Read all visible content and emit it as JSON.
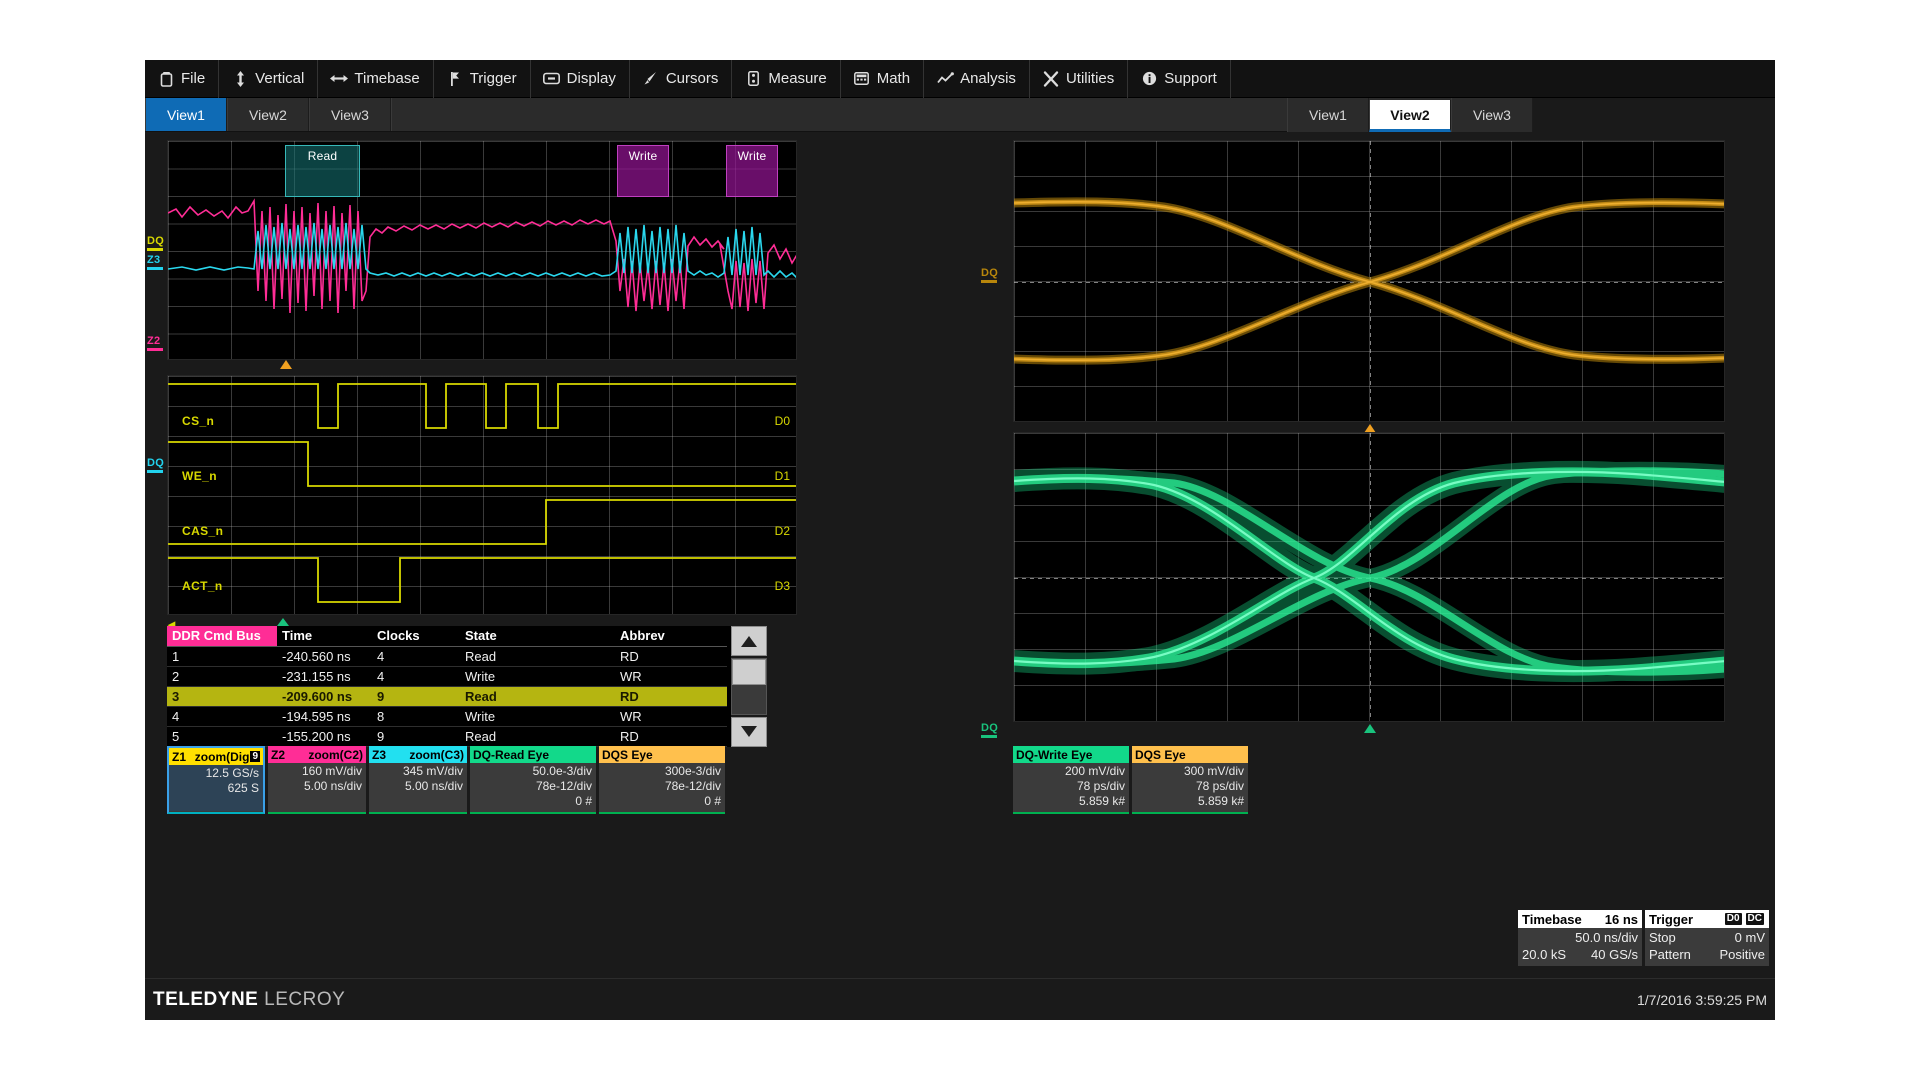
{
  "menu": {
    "items": [
      {
        "label": "File",
        "icon": "file-icon"
      },
      {
        "label": "Vertical",
        "icon": "vertical-arrows-icon"
      },
      {
        "label": "Timebase",
        "icon": "horizontal-arrows-icon"
      },
      {
        "label": "Trigger",
        "icon": "trigger-flag-icon"
      },
      {
        "label": "Display",
        "icon": "display-monitor-icon"
      },
      {
        "label": "Cursors",
        "icon": "cursor-pointer-icon"
      },
      {
        "label": "Measure",
        "icon": "measure-gauge-icon"
      },
      {
        "label": "Math",
        "icon": "math-calculator-icon"
      },
      {
        "label": "Analysis",
        "icon": "analysis-chart-icon"
      },
      {
        "label": "Utilities",
        "icon": "utilities-wrench-icon"
      },
      {
        "label": "Support",
        "icon": "support-info-icon"
      }
    ]
  },
  "tabs_left": {
    "items": [
      "View1",
      "View2",
      "View3"
    ],
    "active": "View1"
  },
  "tabs_right": {
    "items": [
      "View1",
      "View2",
      "View3"
    ],
    "active": "View2"
  },
  "analog_pane": {
    "annotations": [
      {
        "label": "Read",
        "kind": "read"
      },
      {
        "label": "Write",
        "kind": "write"
      },
      {
        "label": "Write",
        "kind": "write"
      }
    ],
    "channel_tags": [
      {
        "label": "DQ",
        "color": "#d8d800"
      },
      {
        "label": "Z3",
        "color": "#22d3ee"
      },
      {
        "label": "Z2",
        "color": "#ff2d96"
      }
    ]
  },
  "digital_pane": {
    "signals": [
      {
        "name": "CS_n",
        "bit": "D0"
      },
      {
        "name": "WE_n",
        "bit": "D1"
      },
      {
        "name": "CAS_n",
        "bit": "D2"
      },
      {
        "name": "ACT_n",
        "bit": "D3"
      }
    ],
    "channel_tag": "DQ"
  },
  "ddr_table": {
    "headers": [
      "DDR Cmd Bus",
      "Time",
      "Clocks",
      "State",
      "Abbrev"
    ],
    "selected_row": 3,
    "rows": [
      {
        "idx": "1",
        "time": "-240.560 ns",
        "clocks": "4",
        "state": "Read",
        "abbrev": "RD"
      },
      {
        "idx": "2",
        "time": "-231.155 ns",
        "clocks": "4",
        "state": "Write",
        "abbrev": "WR"
      },
      {
        "idx": "3",
        "time": "-209.600 ns",
        "clocks": "9",
        "state": "Read",
        "abbrev": "RD"
      },
      {
        "idx": "4",
        "time": "-194.595 ns",
        "clocks": "8",
        "state": "Write",
        "abbrev": "WR"
      },
      {
        "idx": "5",
        "time": "-155.200 ns",
        "clocks": "9",
        "state": "Read",
        "abbrev": "RD"
      }
    ]
  },
  "descriptors_left": [
    {
      "id": "Z1",
      "title": "zoom(Dig",
      "badge": "9",
      "header_color": "#ffe000",
      "header_text_color": "#000000",
      "selected": true,
      "lines": [
        "12.5 GS/s",
        "625 S"
      ]
    },
    {
      "id": "Z2",
      "title": "zoom(C2)",
      "header_color": "#ff2d96",
      "header_text_color": "#000000",
      "selected": false,
      "lines": [
        "160 mV/div",
        "5.00 ns/div"
      ]
    },
    {
      "id": "Z3",
      "title": "zoom(C3)",
      "header_color": "#22e0f0",
      "header_text_color": "#000000",
      "selected": false,
      "lines": [
        "345 mV/div",
        "5.00 ns/div"
      ]
    },
    {
      "id": "",
      "title": "DQ-Read Eye",
      "header_color": "#12d98a",
      "header_text_color": "#000000",
      "selected": false,
      "lines": [
        "50.0e-3/div",
        "78e-12/div",
        "0 #"
      ]
    },
    {
      "id": "",
      "title": "DQS Eye",
      "header_color": "#ffc04d",
      "header_text_color": "#000000",
      "selected": false,
      "lines": [
        "300e-3/div",
        "78e-12/div",
        "0 #"
      ]
    }
  ],
  "descriptors_right": [
    {
      "id": "",
      "title": "DQ-Write Eye",
      "header_color": "#12d98a",
      "header_text_color": "#000000",
      "selected": false,
      "lines": [
        "200 mV/div",
        "78 ps/div",
        "5.859 k#"
      ]
    },
    {
      "id": "",
      "title": "DQS Eye",
      "header_color": "#ffc04d",
      "header_text_color": "#000000",
      "selected": false,
      "lines": [
        "300 mV/div",
        "78 ps/div",
        "5.859 k#"
      ]
    }
  ],
  "eye_panes": {
    "top_tag": "DQ",
    "bottom_tag": "DQ"
  },
  "status": {
    "timebase": {
      "title": "Timebase",
      "value": "16 ns",
      "line2_right": "50.0 ns/div",
      "line3_left": "20.0 kS",
      "line3_right": "40 GS/s"
    },
    "trigger": {
      "title": "Trigger",
      "chip1": "D0",
      "chip2": "DC",
      "line2_left": "Stop",
      "line2_right": "0 mV",
      "line3_left": "Pattern",
      "line3_right": "Positive"
    }
  },
  "footer": {
    "brand_bold": "TELEDYNE",
    "brand_light": "LECROY",
    "datetime": "1/7/2016 3:59:25 PM"
  }
}
